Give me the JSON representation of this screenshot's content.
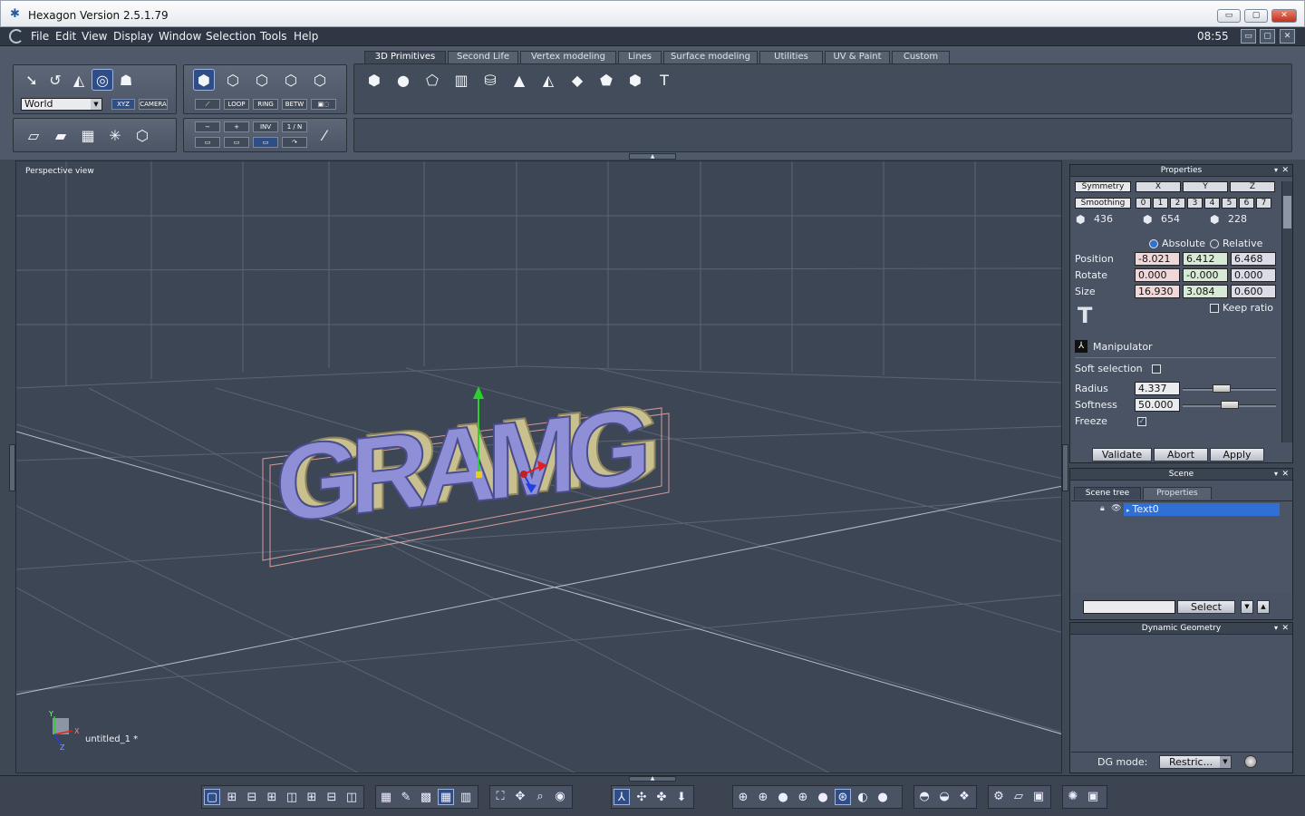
{
  "window": {
    "title": "Hexagon Version 2.5.1.79",
    "min_label": "▭",
    "max_label": "▢",
    "close_label": "✕"
  },
  "menu": {
    "items": [
      "File",
      "Edit",
      "View",
      "Display",
      "Window",
      "Selection",
      "Tools",
      "Help"
    ],
    "clock": "08:55"
  },
  "toolbar_left": {
    "coord_system": "World",
    "xyz_label": "XYZ",
    "camera_label": "CAMERA",
    "loop_label": "LOOP",
    "ring_label": "RING",
    "betw_label": "BETW",
    "minus_label": "−",
    "plus_label": "+",
    "inv_label": "INV",
    "one_n_label": "1 / N"
  },
  "tabs": [
    "3D Primitives",
    "Second Life",
    "Vertex modeling",
    "Lines",
    "Surface modeling",
    "Utilities",
    "UV & Paint",
    "Custom"
  ],
  "active_tab": "3D Primitives",
  "viewport": {
    "label": "Perspective view",
    "scene_text": "GRAMG",
    "doc_name": "untitled_1 *",
    "axis_y": "Y",
    "axis_x": "X",
    "axis_z": "Z"
  },
  "properties": {
    "title": "Properties",
    "symmetry_label": "Symmetry",
    "smoothing_label": "Smoothing",
    "axes": [
      "X",
      "Y",
      "Z"
    ],
    "smoothing_levels": [
      "0",
      "1",
      "2",
      "3",
      "4",
      "5",
      "6",
      "7"
    ],
    "counts": [
      "436",
      "654",
      "228"
    ],
    "absolute_label": "Absolute",
    "relative_label": "Relative",
    "rows": [
      {
        "label": "Position",
        "x": "-8.021",
        "y": "6.412",
        "z": "6.468"
      },
      {
        "label": "Rotate",
        "x": "0.000",
        "y": "-0.000",
        "z": "0.000"
      },
      {
        "label": "Size",
        "x": "16.930",
        "y": "3.084",
        "z": "0.600"
      }
    ],
    "keep_ratio_label": "Keep ratio",
    "manipulator_label": "Manipulator",
    "soft_selection_label": "Soft selection",
    "radius_label": "Radius",
    "radius_value": "4.337",
    "radius_level": 0.4,
    "softness_label": "Softness",
    "softness_value": "50.000",
    "softness_level": 0.5,
    "freeze_label": "Freeze",
    "validate_label": "Validate",
    "abort_label": "Abort",
    "apply_label": "Apply"
  },
  "scene": {
    "title": "Scene",
    "tab_tree": "Scene tree",
    "tab_properties": "Properties",
    "item": "Text0",
    "select_label": "Select"
  },
  "dynamic_geometry": {
    "title": "Dynamic Geometry",
    "dg_mode_label": "DG mode:",
    "dg_mode_value": "Restric..."
  },
  "colors": {
    "accent": "#2f6fd6",
    "viewport_bg": "#3d4655",
    "text_front": "#8e8fd6",
    "text_side": "#cfc79a"
  }
}
